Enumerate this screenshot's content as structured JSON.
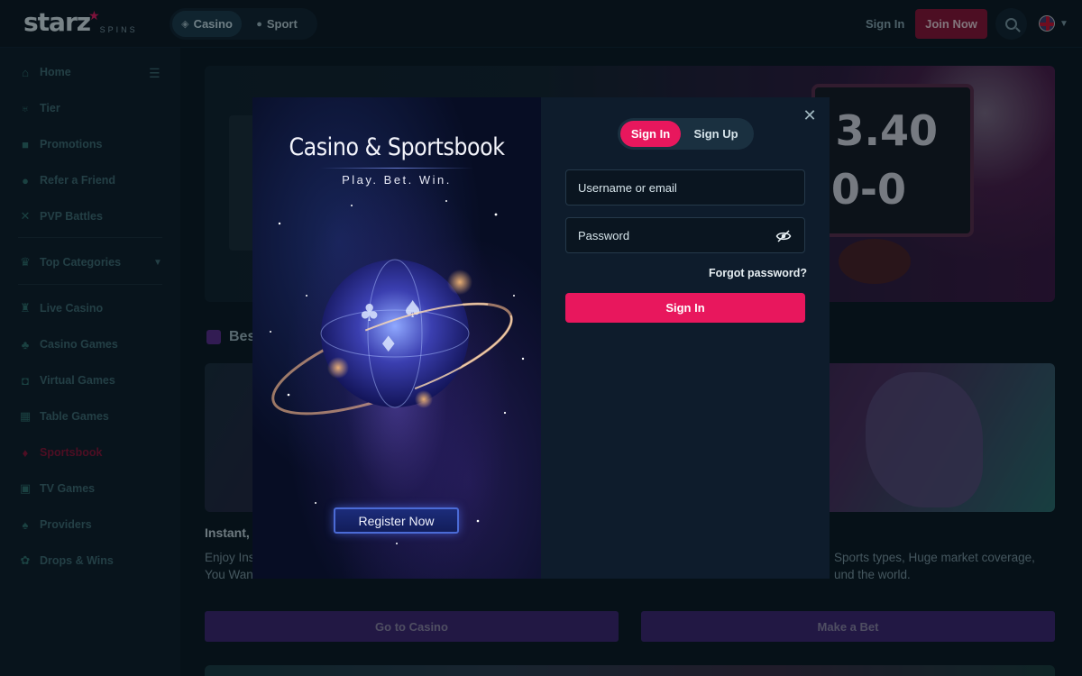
{
  "topbar": {
    "logo_text": "starz",
    "logo_sub": "SPINS",
    "modes": [
      {
        "label": "Casino",
        "icon": "casino-chip-icon",
        "active": true
      },
      {
        "label": "Sport",
        "icon": "ball-icon",
        "active": false
      }
    ],
    "sign_in_label": "Sign In",
    "join_label": "Join Now",
    "search_icon": "search-icon",
    "language_icon": "uk-flag-icon"
  },
  "sidebar": {
    "items": [
      {
        "label": "Home",
        "icon": "home-icon"
      },
      {
        "label": "Tier",
        "icon": "trophy-icon"
      },
      {
        "label": "Promotions",
        "icon": "gift-icon"
      },
      {
        "label": "Refer a Friend",
        "icon": "users-icon"
      },
      {
        "label": "PVP Battles",
        "icon": "swords-icon"
      },
      {
        "label": "Top Categories",
        "icon": "crown-icon"
      },
      {
        "label": "Live Casino",
        "icon": "live-icon"
      },
      {
        "label": "Casino Games",
        "icon": "cards-icon"
      },
      {
        "label": "Virtual Games",
        "icon": "gamepad-icon"
      },
      {
        "label": "Table Games",
        "icon": "table-icon"
      },
      {
        "label": "Sportsbook",
        "icon": "sportsbook-icon"
      },
      {
        "label": "TV Games",
        "icon": "tv-icon"
      },
      {
        "label": "Providers",
        "icon": "provider-icon"
      },
      {
        "label": "Drops & Wins",
        "icon": "drops-icon"
      }
    ],
    "active_item": "Sportsbook"
  },
  "background": {
    "hero_score_top": "3.40",
    "hero_score_bottom": "0-0",
    "section_title": "Bes",
    "left_card_title": "Instant,",
    "left_card_desc": "Enjoy Ins Support You Want.",
    "right_card_desc": "Sports types, Huge market coverage, und the world.",
    "cta_casino": "Go to Casino",
    "cta_bet": "Make a Bet"
  },
  "modal": {
    "promo_title": "Casino & Sportsbook",
    "promo_subtitle": "Play. Bet. Win.",
    "register_label": "Register Now",
    "tabs": [
      {
        "label": "Sign In",
        "active": true
      },
      {
        "label": "Sign Up",
        "active": false
      }
    ],
    "username_placeholder": "Username or email",
    "password_placeholder": "Password",
    "forgot_label": "Forgot password?",
    "submit_label": "Sign In"
  },
  "colors": {
    "accent": "#e8175d",
    "join_button": "#8a1233",
    "cta_purple": "#3d2470",
    "page_bg": "#0d1a24"
  }
}
